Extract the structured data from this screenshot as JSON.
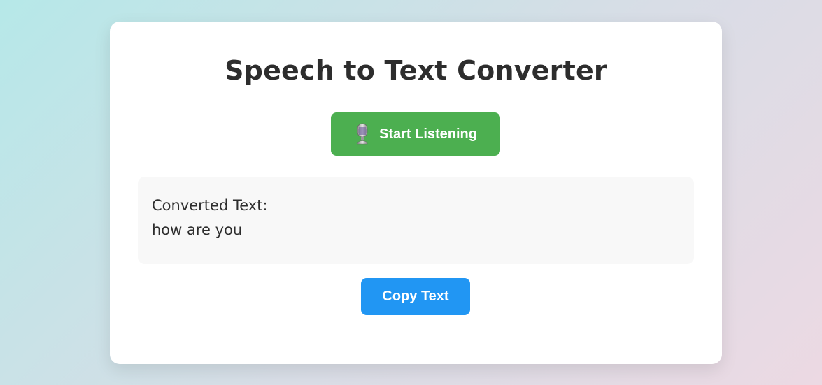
{
  "app": {
    "title": "Speech to Text Converter"
  },
  "controls": {
    "listen_icon": "microphone-icon",
    "listen_label": "Start Listening",
    "copy_label": "Copy Text"
  },
  "output": {
    "label": "Converted Text:",
    "text": "how are you"
  },
  "colors": {
    "listen_button": "#4caf50",
    "copy_button": "#2196f3",
    "card_background": "#ffffff",
    "output_background": "#f8f8f8",
    "title_text": "#2d2d2d"
  }
}
